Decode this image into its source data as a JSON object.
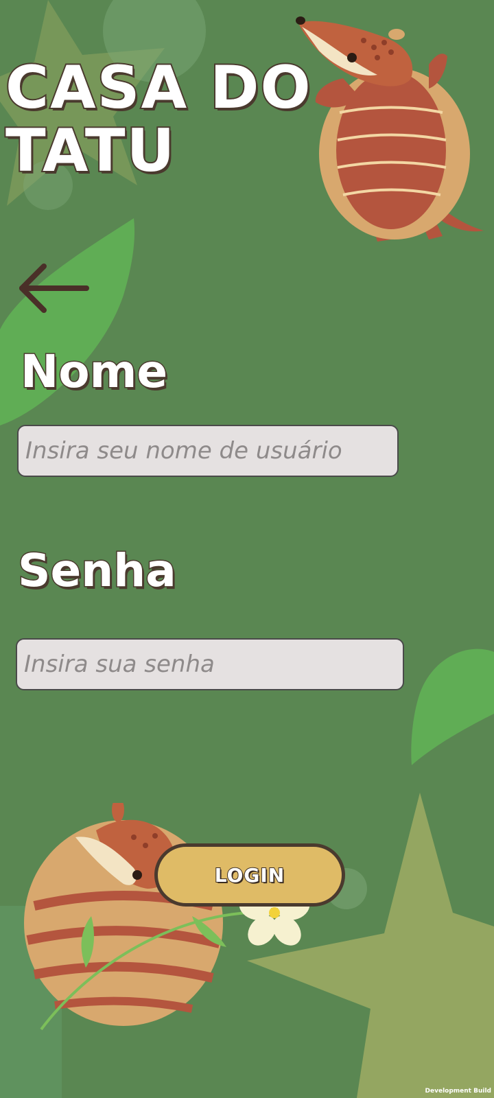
{
  "app": {
    "title": "CASA DO\nTATU"
  },
  "form": {
    "name_label": "Nome",
    "name_placeholder": "Insira seu nome de usuário",
    "password_label": "Senha",
    "password_placeholder": "Insira sua senha",
    "login_label": "LOGIN"
  },
  "footer": {
    "build_label": "Development Build"
  },
  "icons": {
    "back": "arrow-left-icon"
  },
  "colors": {
    "background": "#5a8752",
    "button": "#dfbb66",
    "outline": "#4a3a2e",
    "input": "#e5e1e1"
  }
}
